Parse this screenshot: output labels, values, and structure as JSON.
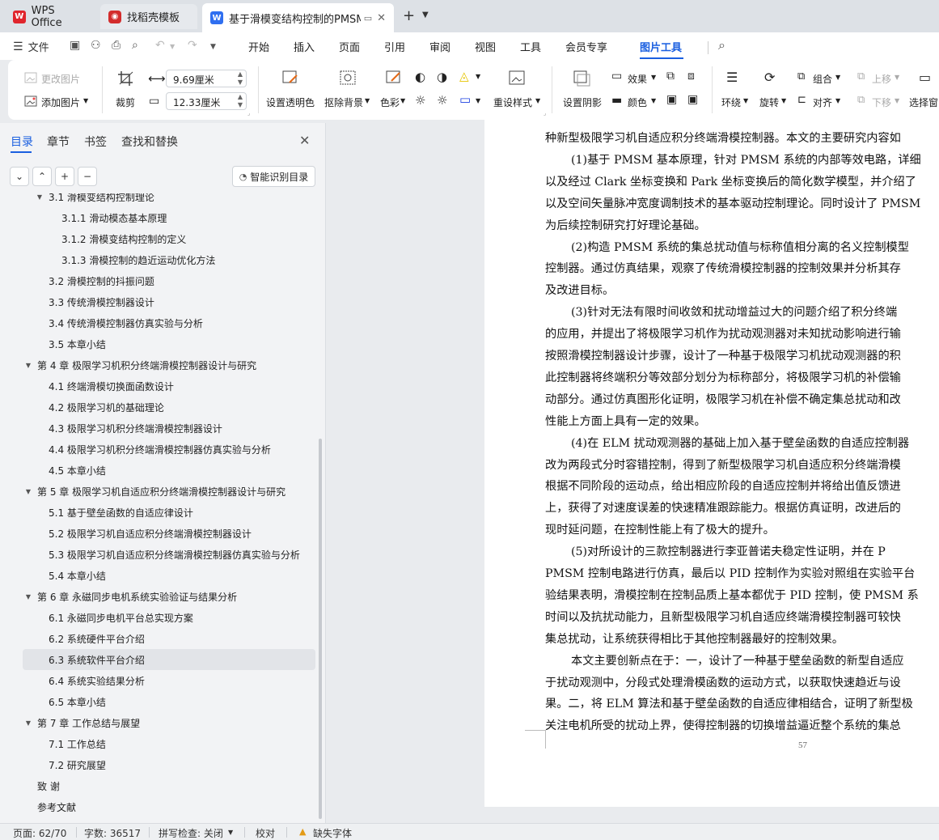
{
  "tabs": {
    "wps": "WPS Office",
    "template": "找稻壳模板",
    "document": "基于滑模变结构控制的PMSM",
    "add": "+",
    "more": "⌄"
  },
  "menu": {
    "file": "文件",
    "items": [
      "开始",
      "插入",
      "页面",
      "引用",
      "审阅",
      "视图",
      "工具",
      "会员专享"
    ],
    "active": "图片工具"
  },
  "ribbon": {
    "change_picture": "更改图片",
    "add_picture": "添加图片",
    "crop": "裁剪",
    "width_value": "9.69厘米",
    "height_value": "12.33厘米",
    "set_transparent": "设置透明色",
    "remove_bg": "抠除背景",
    "color": "色彩",
    "reset_style": "重设样式",
    "set_shadow": "设置阴影",
    "effects": "效果",
    "border_color": "颜色",
    "wrap": "环绕",
    "rotate": "旋转",
    "group": "组合",
    "align": "对齐",
    "move_up": "上移",
    "move_down": "下移",
    "select_pane": "选择窗"
  },
  "nav": {
    "tabs": [
      "目录",
      "章节",
      "书签",
      "查找和替换"
    ],
    "smart_toc": "智能识别目录",
    "toc": [
      {
        "text": "3.1  滑模变结构控制理论",
        "indent": 1,
        "toggle": "open"
      },
      {
        "text": "3.1.1  滑动模态基本原理",
        "indent": 2
      },
      {
        "text": "3.1.2  滑模变结构控制的定义",
        "indent": 2
      },
      {
        "text": "3.1.3  滑模控制的趋近运动优化方法",
        "indent": 2
      },
      {
        "text": "3.2  滑模控制的抖振问题",
        "indent": 1
      },
      {
        "text": "3.3  传统滑模控制器设计",
        "indent": 1
      },
      {
        "text": "3.4  传统滑模控制器仿真实验与分析",
        "indent": 1
      },
      {
        "text": "3.5  本章小结",
        "indent": 1
      },
      {
        "text": "第 4 章  极限学习机积分终端滑模控制器设计与研究",
        "indent": 0,
        "toggle": "open"
      },
      {
        "text": "4.1  终端滑模切换面函数设计",
        "indent": 1
      },
      {
        "text": "4.2  极限学习机的基础理论",
        "indent": 1
      },
      {
        "text": "4.3  极限学习机积分终端滑模控制器设计",
        "indent": 1
      },
      {
        "text": "4.4  极限学习机积分终端滑模控制器仿真实验与分析",
        "indent": 1
      },
      {
        "text": "4.5  本章小结",
        "indent": 1
      },
      {
        "text": "第 5 章  极限学习机自适应积分终端滑模控制器设计与研究",
        "indent": 0,
        "toggle": "open"
      },
      {
        "text": "5.1  基于壁垒函数的自适应律设计",
        "indent": 1
      },
      {
        "text": "5.2  极限学习机自适应积分终端滑模控制器设计",
        "indent": 1
      },
      {
        "text": "5.3  极限学习机自适应积分终端滑模控制器仿真实验与分析",
        "indent": 1
      },
      {
        "text": "5.4  本章小结",
        "indent": 1
      },
      {
        "text": "第 6 章  永磁同步电机系统实验验证与结果分析",
        "indent": 0,
        "toggle": "open"
      },
      {
        "text": "6.1  永磁同步电机平台总实现方案",
        "indent": 1
      },
      {
        "text": "6.2  系统硬件平台介绍",
        "indent": 1
      },
      {
        "text": "6.3  系统软件平台介绍",
        "indent": 1,
        "selected": true
      },
      {
        "text": "6.4  系统实验结果分析",
        "indent": 1
      },
      {
        "text": "6.5  本章小结",
        "indent": 1
      },
      {
        "text": "第 7 章  工作总结与展望",
        "indent": 0,
        "toggle": "open"
      },
      {
        "text": "7.1  工作总结",
        "indent": 1
      },
      {
        "text": "7.2  研究展望",
        "indent": 1
      },
      {
        "text": "致    谢",
        "indent": 0
      },
      {
        "text": "参考文献",
        "indent": 0
      }
    ]
  },
  "document": {
    "lines": [
      {
        "text": "种新型极限学习机自适应积分终端滑模控制器。本文的主要研究内容如",
        "indent": false
      },
      {
        "text": "(1)基于 PMSM 基本原理，针对 PMSM 系统的内部等效电路，详细",
        "indent": true
      },
      {
        "text": "以及经过 Clark 坐标变换和 Park 坐标变换后的简化数学模型，并介绍了",
        "indent": false
      },
      {
        "text": "以及空间矢量脉冲宽度调制技术的基本驱动控制理论。同时设计了 PMSM",
        "indent": false
      },
      {
        "text": "为后续控制研究打好理论基础。",
        "indent": false
      },
      {
        "text": "(2)构造 PMSM 系统的集总扰动值与标称值相分离的名义控制模型",
        "indent": true
      },
      {
        "text": "控制器。通过仿真结果，观察了传统滑模控制器的控制效果并分析其存",
        "indent": false
      },
      {
        "text": "及改进目标。",
        "indent": false
      },
      {
        "text": "(3)针对无法有限时间收敛和扰动增益过大的问题介绍了积分终端",
        "indent": true
      },
      {
        "text": "的应用，并提出了将极限学习机作为扰动观测器对未知扰动影响进行输",
        "indent": false
      },
      {
        "text": "按照滑模控制器设计步骤，设计了一种基于极限学习机扰动观测器的积",
        "indent": false
      },
      {
        "text": "此控制器将终端积分等效部分划分为标称部分，将极限学习机的补偿输",
        "indent": false
      },
      {
        "text": "动部分。通过仿真图形化证明，极限学习机在补偿不确定集总扰动和改",
        "indent": false
      },
      {
        "text": "性能上方面上具有一定的效果。",
        "indent": false
      },
      {
        "text": "(4)在 ELM 扰动观测器的基础上加入基于壁垒函数的自适应控制器",
        "indent": true
      },
      {
        "text": "改为两段式分时容错控制，得到了新型极限学习机自适应积分终端滑模",
        "indent": false
      },
      {
        "text": "根据不同阶段的运动点，给出相应阶段的自适应控制并将给出值反馈进",
        "indent": false
      },
      {
        "text": "上，获得了对速度误差的快速精准跟踪能力。根据仿真证明，改进后的",
        "indent": false
      },
      {
        "text": "现时延问题，在控制性能上有了极大的提升。",
        "indent": false
      },
      {
        "text": "(5)对所设计的三款控制器进行李亚普诺夫稳定性证明，并在 P",
        "indent": true
      },
      {
        "text": "PMSM 控制电路进行仿真，最后以 PID 控制作为实验对照组在实验平台",
        "indent": false
      },
      {
        "text": "验结果表明，滑模控制在控制品质上基本都优于 PID 控制，使 PMSM 系",
        "indent": false
      },
      {
        "text": "时间以及抗扰动能力，且新型极限学习机自适应终端滑模控制器可较快",
        "indent": false
      },
      {
        "text": "集总扰动，让系统获得相比于其他控制器最好的控制效果。",
        "indent": false
      },
      {
        "text": "本文主要创新点在于：一，设计了一种基于壁垒函数的新型自适应",
        "indent": true
      },
      {
        "text": "于扰动观测中，分段式处理滑模函数的运动方式，以获取快速趋近与设",
        "indent": false
      },
      {
        "text": "果。二，将 ELM 算法和基于壁垒函数的自适应律相结合，证明了新型极",
        "indent": false
      },
      {
        "text": "关注电机所受的扰动上界，使得控制器的切换增益逼近整个系统的集总",
        "indent": false
      }
    ],
    "page_number": "57"
  },
  "status": {
    "page": "页面: 62/70",
    "words": "字数: 36517",
    "spell": "拼写检查: 关闭",
    "proof": "校对",
    "missing_font": "缺失字体"
  }
}
